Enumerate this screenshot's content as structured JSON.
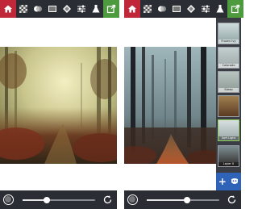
{
  "toolbar": {
    "icons": [
      "home-icon",
      "checkerboard-icon",
      "blend-icon",
      "image-icon",
      "diamond-icon",
      "sliders-icon",
      "flask-icon",
      "export-icon"
    ],
    "colors": {
      "bar": "#2a2d33",
      "home": "#c0283a",
      "export": "#4e9a3f"
    }
  },
  "left_screen": {
    "slider_value": 0.33
  },
  "right_screen": {
    "slider_value": 0.55,
    "layers": [
      {
        "label": "Frozen Ivy"
      },
      {
        "label": "Colorado"
      },
      {
        "label": "Steep"
      },
      {
        "label": ""
      },
      {
        "label": "Soft Light",
        "selected": true
      },
      {
        "label": "Layer 0"
      }
    ],
    "panel_footer": {
      "add": "+",
      "mask_icon": "mask-icon"
    }
  },
  "colors": {
    "accent": "#2f63b8",
    "selected_layer": "#8ecf5a"
  }
}
